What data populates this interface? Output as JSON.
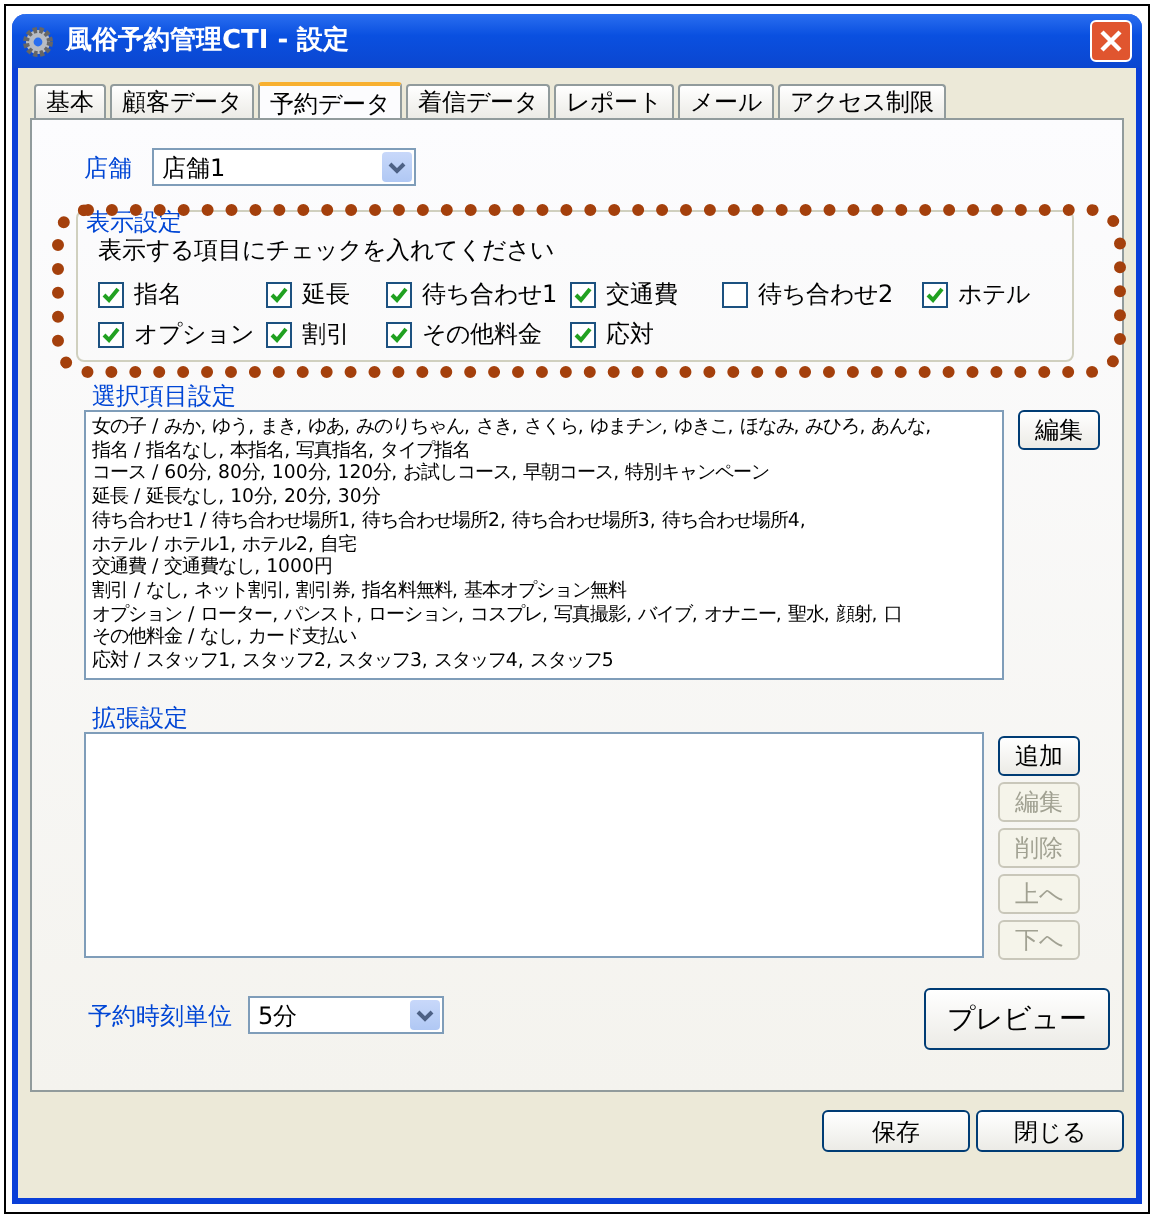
{
  "window": {
    "title": "風俗予約管理CTI - 設定"
  },
  "tabs": [
    {
      "label": "基本",
      "selected": false
    },
    {
      "label": "顧客データ",
      "selected": false
    },
    {
      "label": "予約データ",
      "selected": true
    },
    {
      "label": "着信データ",
      "selected": false
    },
    {
      "label": "レポート",
      "selected": false
    },
    {
      "label": "メール",
      "selected": false
    },
    {
      "label": "アクセス制限",
      "selected": false
    }
  ],
  "store": {
    "label": "店舗",
    "value": "店舗1"
  },
  "display_settings": {
    "title": "表示設定",
    "instruction": "表示する項目にチェックを入れてください",
    "highlighted": true,
    "items": [
      {
        "label": "指名",
        "checked": true
      },
      {
        "label": "延長",
        "checked": true
      },
      {
        "label": "待ち合わせ1",
        "checked": true
      },
      {
        "label": "交通費",
        "checked": true
      },
      {
        "label": "待ち合わせ2",
        "checked": false
      },
      {
        "label": "ホテル",
        "checked": true
      },
      {
        "label": "オプション",
        "checked": true
      },
      {
        "label": "割引",
        "checked": true
      },
      {
        "label": "その他料金",
        "checked": true
      },
      {
        "label": "応対",
        "checked": true
      }
    ]
  },
  "choice_settings": {
    "title": "選択項目設定",
    "edit_button": "編集",
    "lines": [
      "女の子 / みか, ゆう, まき, ゆあ, みのりちゃん, さき, さくら, ゆまチン, ゆきこ, ほなみ, みひろ, あんな,",
      "指名 / 指名なし, 本指名, 写真指名, タイプ指名",
      "コース / 60分, 80分, 100分, 120分, お試しコース, 早朝コース, 特別キャンペーン",
      "延長 / 延長なし, 10分, 20分, 30分",
      "待ち合わせ1 / 待ち合わせ場所1, 待ち合わせ場所2, 待ち合わせ場所3, 待ち合わせ場所4,",
      "ホテル / ホテル1, ホテル2, 自宅",
      "交通費 / 交通費なし, 1000円",
      "割引 / なし, ネット割引, 割引券, 指名料無料, 基本オプション無料",
      "オプション / ローター, パンスト, ローション, コスプレ, 写真撮影, バイブ, オナニー, 聖水, 顔射, 口",
      "その他料金 / なし, カード支払い",
      "応対 / スタッフ1, スタッフ2, スタッフ3, スタッフ4, スタッフ5"
    ]
  },
  "extended_settings": {
    "title": "拡張設定",
    "buttons": [
      {
        "label": "追加",
        "disabled": false
      },
      {
        "label": "編集",
        "disabled": true
      },
      {
        "label": "削除",
        "disabled": true
      },
      {
        "label": "上へ",
        "disabled": true
      },
      {
        "label": "下へ",
        "disabled": true
      }
    ]
  },
  "time_unit": {
    "label": "予約時刻単位",
    "value": "5分"
  },
  "preview_button": "プレビュー",
  "footer_buttons": [
    "保存",
    "閉じる"
  ]
}
